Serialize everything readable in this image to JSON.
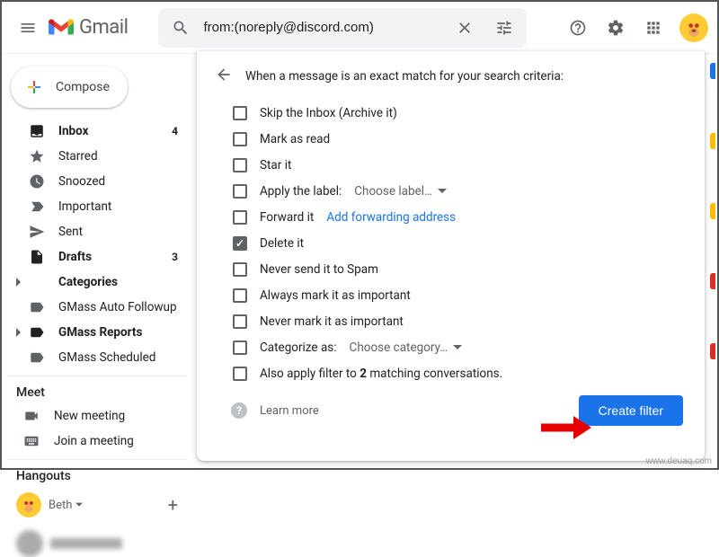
{
  "app": {
    "name": "Gmail"
  },
  "search": {
    "query": "from:(noreply@discord.com)"
  },
  "compose": {
    "label": "Compose"
  },
  "nav": {
    "items": [
      {
        "label": "Inbox",
        "count": "4",
        "bold": true
      },
      {
        "label": "Starred"
      },
      {
        "label": "Snoozed"
      },
      {
        "label": "Important"
      },
      {
        "label": "Sent"
      },
      {
        "label": "Drafts",
        "count": "3",
        "bold": true
      },
      {
        "label": "Categories",
        "bold": true,
        "caret": true
      },
      {
        "label": "GMass Auto Followup",
        "indent": true
      },
      {
        "label": "GMass Reports",
        "bold": true,
        "caret": true
      },
      {
        "label": "GMass Scheduled",
        "indent": true
      }
    ]
  },
  "meet": {
    "header": "Meet",
    "new": "New meeting",
    "join": "Join a meeting"
  },
  "hangouts": {
    "header": "Hangouts",
    "name": "Beth"
  },
  "filter": {
    "header": "When a message is an exact match for your search criteria:",
    "options": {
      "skip": "Skip the Inbox (Archive it)",
      "read": "Mark as read",
      "star": "Star it",
      "apply_label": "Apply the label:",
      "choose_label": "Choose label…",
      "forward": "Forward it",
      "forward_link": "Add forwarding address",
      "delete": "Delete it",
      "never_spam": "Never send it to Spam",
      "always_important": "Always mark it as important",
      "never_important": "Never mark it as important",
      "categorize": "Categorize as:",
      "choose_category": "Choose category…",
      "also_apply_pre": "Also apply filter to ",
      "also_apply_count": "2",
      "also_apply_post": " matching conversations."
    },
    "learn_more": "Learn more",
    "create": "Create filter"
  },
  "checked": {
    "delete": true
  },
  "watermark": "www.deuaq.com"
}
